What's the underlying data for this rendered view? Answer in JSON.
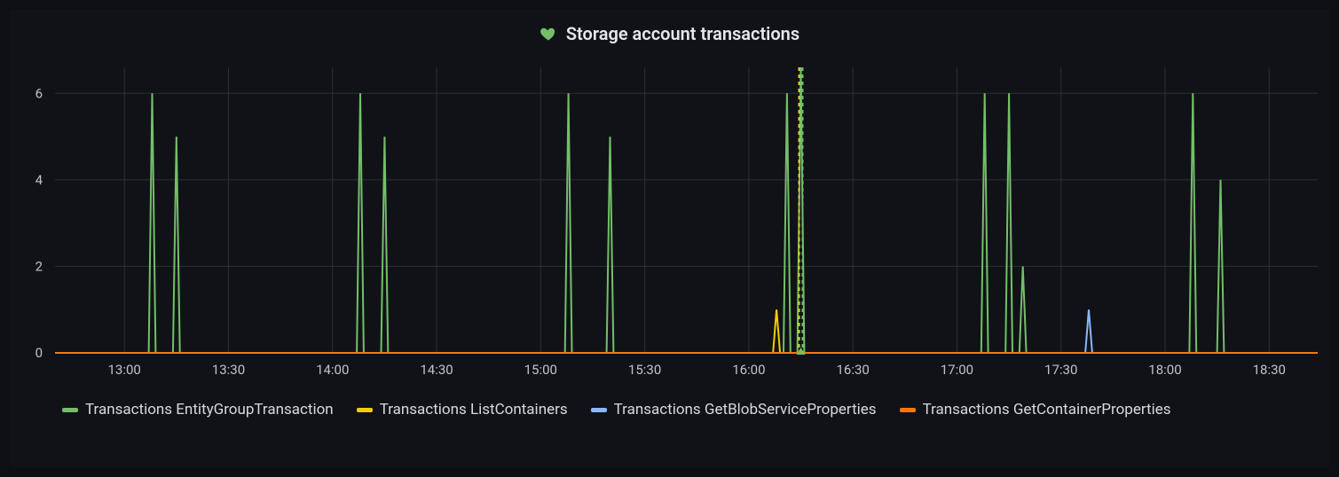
{
  "title": "Storage account transactions",
  "title_icon": "heart-green",
  "colors": {
    "green": "#73bf69",
    "yellow": "#f2cc0c",
    "blue": "#8ab8ff",
    "orange": "#ff780a",
    "grid": "#2c2f33",
    "text": "#bfc3c8"
  },
  "chart_data": {
    "type": "line",
    "xlabel": "",
    "ylabel": "",
    "y_ticks": [
      0,
      2,
      4,
      6
    ],
    "ylim": [
      0,
      6.6
    ],
    "x_ticks_min": [
      780,
      810,
      840,
      870,
      900,
      930,
      960,
      990,
      1020,
      1050,
      1080,
      1110
    ],
    "x_tick_labels": [
      "13:00",
      "13:30",
      "14:00",
      "14:30",
      "15:00",
      "15:30",
      "16:00",
      "16:30",
      "17:00",
      "17:30",
      "18:00",
      "18:30"
    ],
    "xlim_min": [
      760,
      1124
    ],
    "sample_step_min": 1,
    "annotation_x_min": 975,
    "series": [
      {
        "name": "Transactions EntityGroupTransaction",
        "color": "green",
        "spikes": [
          {
            "x": 788,
            "y": 6
          },
          {
            "x": 795,
            "y": 5
          },
          {
            "x": 848,
            "y": 6
          },
          {
            "x": 855,
            "y": 5
          },
          {
            "x": 908,
            "y": 6
          },
          {
            "x": 920,
            "y": 5
          },
          {
            "x": 971,
            "y": 6
          },
          {
            "x": 975,
            "y": 6.6
          },
          {
            "x": 1028,
            "y": 6
          },
          {
            "x": 1035,
            "y": 6
          },
          {
            "x": 1039,
            "y": 2
          },
          {
            "x": 1088,
            "y": 6
          },
          {
            "x": 1096,
            "y": 4
          }
        ]
      },
      {
        "name": "Transactions ListContainers",
        "color": "yellow",
        "spikes": [
          {
            "x": 968,
            "y": 1
          }
        ]
      },
      {
        "name": "Transactions GetBlobServiceProperties",
        "color": "blue",
        "spikes": [
          {
            "x": 1058,
            "y": 1
          }
        ]
      },
      {
        "name": "Transactions GetContainerProperties",
        "color": "orange",
        "spikes": []
      }
    ]
  },
  "legend": [
    {
      "label": "Transactions EntityGroupTransaction",
      "color": "green"
    },
    {
      "label": "Transactions ListContainers",
      "color": "yellow"
    },
    {
      "label": "Transactions GetBlobServiceProperties",
      "color": "blue"
    },
    {
      "label": "Transactions GetContainerProperties",
      "color": "orange"
    }
  ]
}
